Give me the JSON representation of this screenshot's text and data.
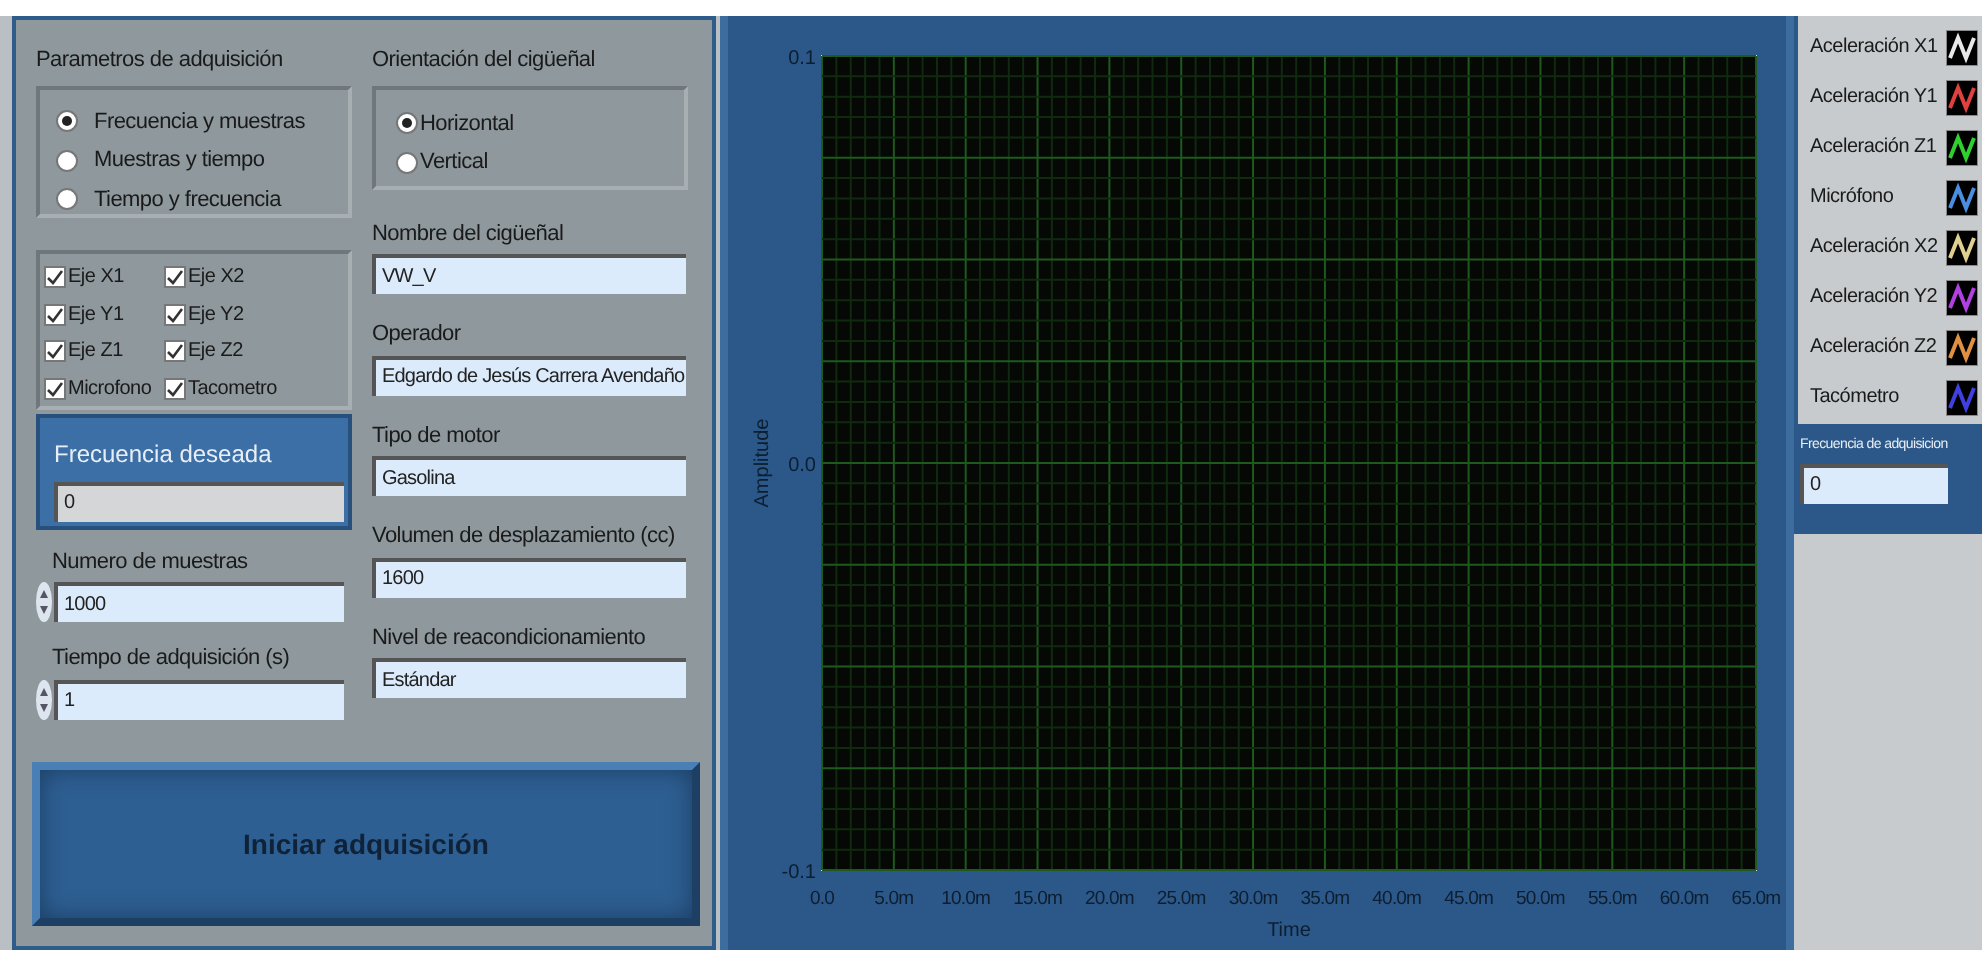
{
  "acquisition": {
    "title": "Parametros de adquisición",
    "modes": [
      {
        "label": "Frecuencia y muestras",
        "selected": true
      },
      {
        "label": "Muestras y tiempo",
        "selected": false
      },
      {
        "label": "Tiempo y frecuencia",
        "selected": false
      }
    ]
  },
  "channels": [
    {
      "label": "Eje X1",
      "checked": true
    },
    {
      "label": "Eje X2",
      "checked": true
    },
    {
      "label": "Eje Y1",
      "checked": true
    },
    {
      "label": "Eje Y2",
      "checked": true
    },
    {
      "label": "Eje Z1",
      "checked": true
    },
    {
      "label": "Eje Z2",
      "checked": true
    },
    {
      "label": "Microfono",
      "checked": true
    },
    {
      "label": "Tacometro",
      "checked": true
    }
  ],
  "desired_frequency": {
    "label": "Frecuencia deseada",
    "value": "0"
  },
  "samples": {
    "label": "Numero de muestras",
    "value": "1000"
  },
  "acq_time": {
    "label": "Tiempo de adquisición (s)",
    "value": "1"
  },
  "start_button": "Iniciar adquisición",
  "orientation": {
    "title": "Orientación del cigüeñal",
    "options": [
      {
        "label": "Horizontal",
        "selected": true
      },
      {
        "label": "Vertical",
        "selected": false
      }
    ]
  },
  "fields": [
    {
      "label": "Nombre del cigüeñal",
      "value": "VW_V"
    },
    {
      "label": "Operador",
      "value": "Edgardo de Jesús Carrera Avendaño"
    },
    {
      "label": "Tipo de motor",
      "value": "Gasolina"
    },
    {
      "label": "Volumen de desplazamiento (cc)",
      "value": "1600"
    },
    {
      "label": "Nivel de reacondicionamiento",
      "value": "Estándar"
    }
  ],
  "chart": {
    "chart_data": {
      "type": "line",
      "grid": true,
      "xlabel": "Time",
      "ylabel": "Amplitude",
      "xlim": [
        0,
        65
      ],
      "ylim": [
        -0.1,
        0.1
      ],
      "xticks": [
        {
          "value": 0,
          "label": "0.0"
        },
        {
          "value": 5,
          "label": "5.0m"
        },
        {
          "value": 10,
          "label": "10.0m"
        },
        {
          "value": 15,
          "label": "15.0m"
        },
        {
          "value": 20,
          "label": "20.0m"
        },
        {
          "value": 25,
          "label": "25.0m"
        },
        {
          "value": 30,
          "label": "30.0m"
        },
        {
          "value": 35,
          "label": "35.0m"
        },
        {
          "value": 40,
          "label": "40.0m"
        },
        {
          "value": 45,
          "label": "45.0m"
        },
        {
          "value": 50,
          "label": "50.0m"
        },
        {
          "value": 55,
          "label": "55.0m"
        },
        {
          "value": 60,
          "label": "60.0m"
        },
        {
          "value": 65,
          "label": "65.0m"
        }
      ],
      "yticks": [
        {
          "value": 0.1,
          "label": "0.1"
        },
        {
          "value": 0,
          "label": "0.0"
        },
        {
          "value": -0.1,
          "label": "-0.1"
        }
      ]
    }
  },
  "legend": [
    {
      "label": "Aceleración X1",
      "color": "#e8e8e8"
    },
    {
      "label": "Aceleración Y1",
      "color": "#e04040"
    },
    {
      "label": "Aceleración Z1",
      "color": "#30d030"
    },
    {
      "label": "Micrófono",
      "color": "#4a8ee0"
    },
    {
      "label": "Aceleración X2",
      "color": "#e0d090"
    },
    {
      "label": "Aceleración Y2",
      "color": "#b040e0"
    },
    {
      "label": "Aceleración Z2",
      "color": "#e09040"
    },
    {
      "label": "Tacómetro",
      "color": "#4040e0"
    }
  ],
  "acq_frequency": {
    "label": "Frecuencia de adquisicion",
    "value": "0"
  }
}
